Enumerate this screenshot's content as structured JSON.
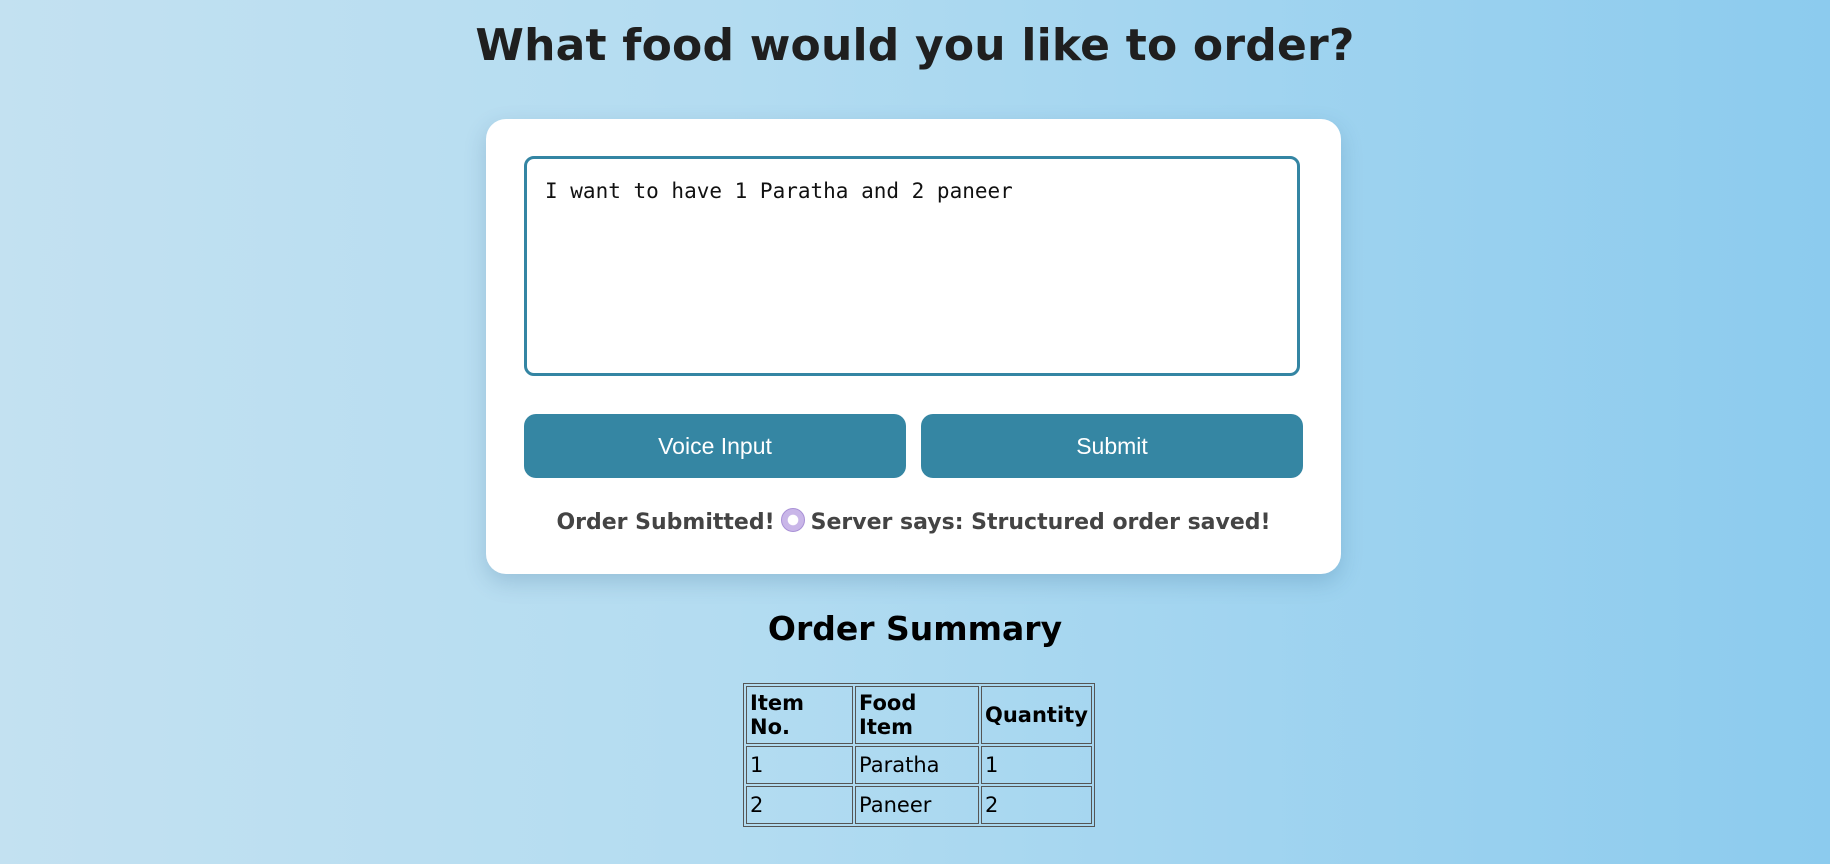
{
  "page": {
    "title": "What food would you like to order?"
  },
  "order_form": {
    "input_value": "I want to have 1 Paratha and 2 paneer",
    "voice_button_label": "Voice Input",
    "submit_button_label": "Submit",
    "status_prefix": "Order Submitted!",
    "status_icon": "plate-with-cutlery-icon",
    "status_suffix": "Server says: Structured order saved!"
  },
  "summary": {
    "title": "Order Summary",
    "headers": [
      "Item No.",
      "Food Item",
      "Quantity"
    ],
    "rows": [
      [
        "1",
        "Paratha",
        "1"
      ],
      [
        "2",
        "Paneer",
        "2"
      ]
    ]
  },
  "colors": {
    "accent": "#3586a3",
    "background_start": "#c3e1f1",
    "background_end": "#8ccbee",
    "card": "#ffffff",
    "status_text": "#444444"
  }
}
